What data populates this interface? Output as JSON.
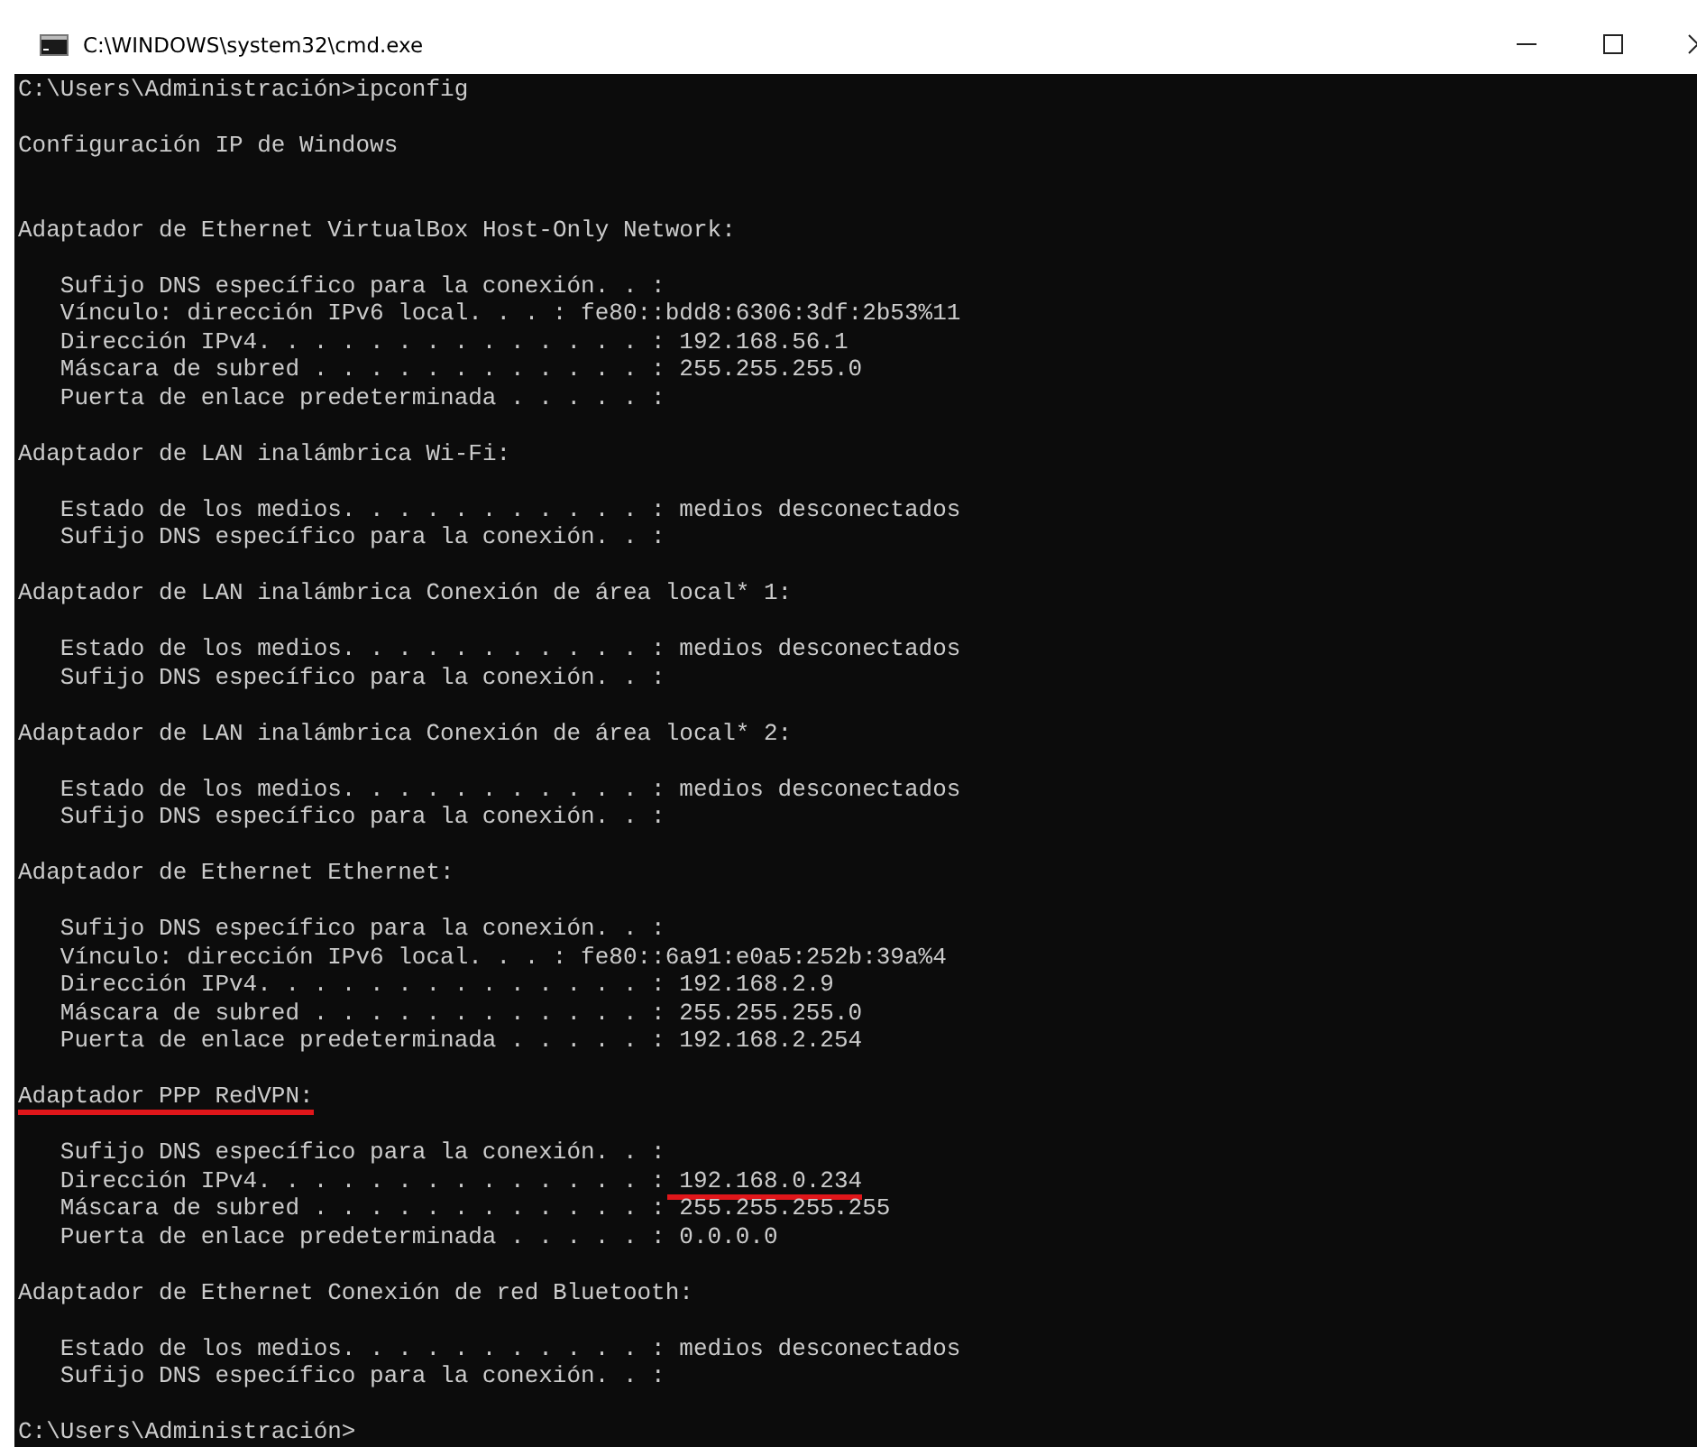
{
  "window": {
    "title": "C:\\WINDOWS\\system32\\cmd.exe"
  },
  "console": {
    "lines": [
      {
        "kind": "text",
        "text": "C:\\Users\\Administración>ipconfig"
      },
      {
        "kind": "blank"
      },
      {
        "kind": "text",
        "text": "Configuración IP de Windows"
      },
      {
        "kind": "blank"
      },
      {
        "kind": "blank"
      },
      {
        "kind": "heading",
        "text": "Adaptador de Ethernet VirtualBox Host-Only Network:",
        "underlined": false
      },
      {
        "kind": "blank"
      },
      {
        "kind": "field",
        "label": "Sufijo DNS específico para la conexión. . :"
      },
      {
        "kind": "field",
        "label": "Vínculo: dirección IPv6 local. . . :",
        "value": "fe80::bdd8:6306:3df:2b53%11",
        "underlined": false
      },
      {
        "kind": "field",
        "label": "Dirección IPv4. . . . . . . . . . . . . . :",
        "value": "192.168.56.1",
        "underlined": false
      },
      {
        "kind": "field",
        "label": "Máscara de subred . . . . . . . . . . . . :",
        "value": "255.255.255.0",
        "underlined": false
      },
      {
        "kind": "field",
        "label": "Puerta de enlace predeterminada . . . . . :"
      },
      {
        "kind": "blank"
      },
      {
        "kind": "heading",
        "text": "Adaptador de LAN inalámbrica Wi-Fi:",
        "underlined": false
      },
      {
        "kind": "blank"
      },
      {
        "kind": "field",
        "label": "Estado de los medios. . . . . . . . . . . :",
        "value": "medios desconectados",
        "underlined": false
      },
      {
        "kind": "field",
        "label": "Sufijo DNS específico para la conexión. . :"
      },
      {
        "kind": "blank"
      },
      {
        "kind": "heading",
        "text": "Adaptador de LAN inalámbrica Conexión de área local* 1:",
        "underlined": false
      },
      {
        "kind": "blank"
      },
      {
        "kind": "field",
        "label": "Estado de los medios. . . . . . . . . . . :",
        "value": "medios desconectados",
        "underlined": false
      },
      {
        "kind": "field",
        "label": "Sufijo DNS específico para la conexión. . :"
      },
      {
        "kind": "blank"
      },
      {
        "kind": "heading",
        "text": "Adaptador de LAN inalámbrica Conexión de área local* 2:",
        "underlined": false
      },
      {
        "kind": "blank"
      },
      {
        "kind": "field",
        "label": "Estado de los medios. . . . . . . . . . . :",
        "value": "medios desconectados",
        "underlined": false
      },
      {
        "kind": "field",
        "label": "Sufijo DNS específico para la conexión. . :"
      },
      {
        "kind": "blank"
      },
      {
        "kind": "heading",
        "text": "Adaptador de Ethernet Ethernet:",
        "underlined": false
      },
      {
        "kind": "blank"
      },
      {
        "kind": "field",
        "label": "Sufijo DNS específico para la conexión. . :"
      },
      {
        "kind": "field",
        "label": "Vínculo: dirección IPv6 local. . . :",
        "value": "fe80::6a91:e0a5:252b:39a%4",
        "underlined": false
      },
      {
        "kind": "field",
        "label": "Dirección IPv4. . . . . . . . . . . . . . :",
        "value": "192.168.2.9",
        "underlined": false
      },
      {
        "kind": "field",
        "label": "Máscara de subred . . . . . . . . . . . . :",
        "value": "255.255.255.0",
        "underlined": false
      },
      {
        "kind": "field",
        "label": "Puerta de enlace predeterminada . . . . . :",
        "value": "192.168.2.254",
        "underlined": false
      },
      {
        "kind": "blank"
      },
      {
        "kind": "heading",
        "text": "Adaptador PPP RedVPN:",
        "underlined": true
      },
      {
        "kind": "blank"
      },
      {
        "kind": "field",
        "label": "Sufijo DNS específico para la conexión. . :"
      },
      {
        "kind": "field",
        "label": "Dirección IPv4. . . . . . . . . . . . . . :",
        "value": "192.168.0.234",
        "underlined": true
      },
      {
        "kind": "field",
        "label": "Máscara de subred . . . . . . . . . . . . :",
        "value": "255.255.255.255",
        "underlined": false
      },
      {
        "kind": "field",
        "label": "Puerta de enlace predeterminada . . . . . :",
        "value": "0.0.0.0",
        "underlined": false
      },
      {
        "kind": "blank"
      },
      {
        "kind": "heading",
        "text": "Adaptador de Ethernet Conexión de red Bluetooth:",
        "underlined": false
      },
      {
        "kind": "blank"
      },
      {
        "kind": "field",
        "label": "Estado de los medios. . . . . . . . . . . :",
        "value": "medios desconectados",
        "underlined": false
      },
      {
        "kind": "field",
        "label": "Sufijo DNS específico para la conexión. . :"
      },
      {
        "kind": "blank"
      },
      {
        "kind": "text",
        "text": "C:\\Users\\Administración>"
      }
    ]
  }
}
